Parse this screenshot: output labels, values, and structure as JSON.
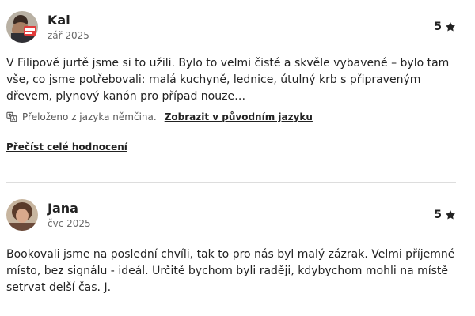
{
  "reviews": [
    {
      "name": "Kai",
      "date": "zář 2025",
      "rating": "5",
      "text": "V Filipově jurtě jsme si to užili. Bylo to velmi čisté a skvěle vybavené – bylo tam vše, co jsme potřebovali: malá kuchyně, lednice, útulný krb s připraveným dřevem, plynový kanón pro případ nouze…",
      "translation_note": "Přeloženo z jazyka němčina.",
      "show_original": "Zobrazit v původním jazyku",
      "read_more": "Přečíst celé hodnocení"
    },
    {
      "name": "Jana",
      "date": "čvc 2025",
      "rating": "5",
      "text": "Bookovali jsme na poslední chvíli, tak to pro nás byl malý zázrak. Velmi příjemné místo, bez signálu - ideál. Určitě bychom byli raději, kdybychom mohli na místě setrvat delší čas. J."
    }
  ],
  "icons": {
    "star": "star-icon",
    "translate": "translate-icon"
  },
  "colors": {
    "text": "#222222",
    "muted": "#6a6a6a",
    "divider": "#dddddd"
  }
}
